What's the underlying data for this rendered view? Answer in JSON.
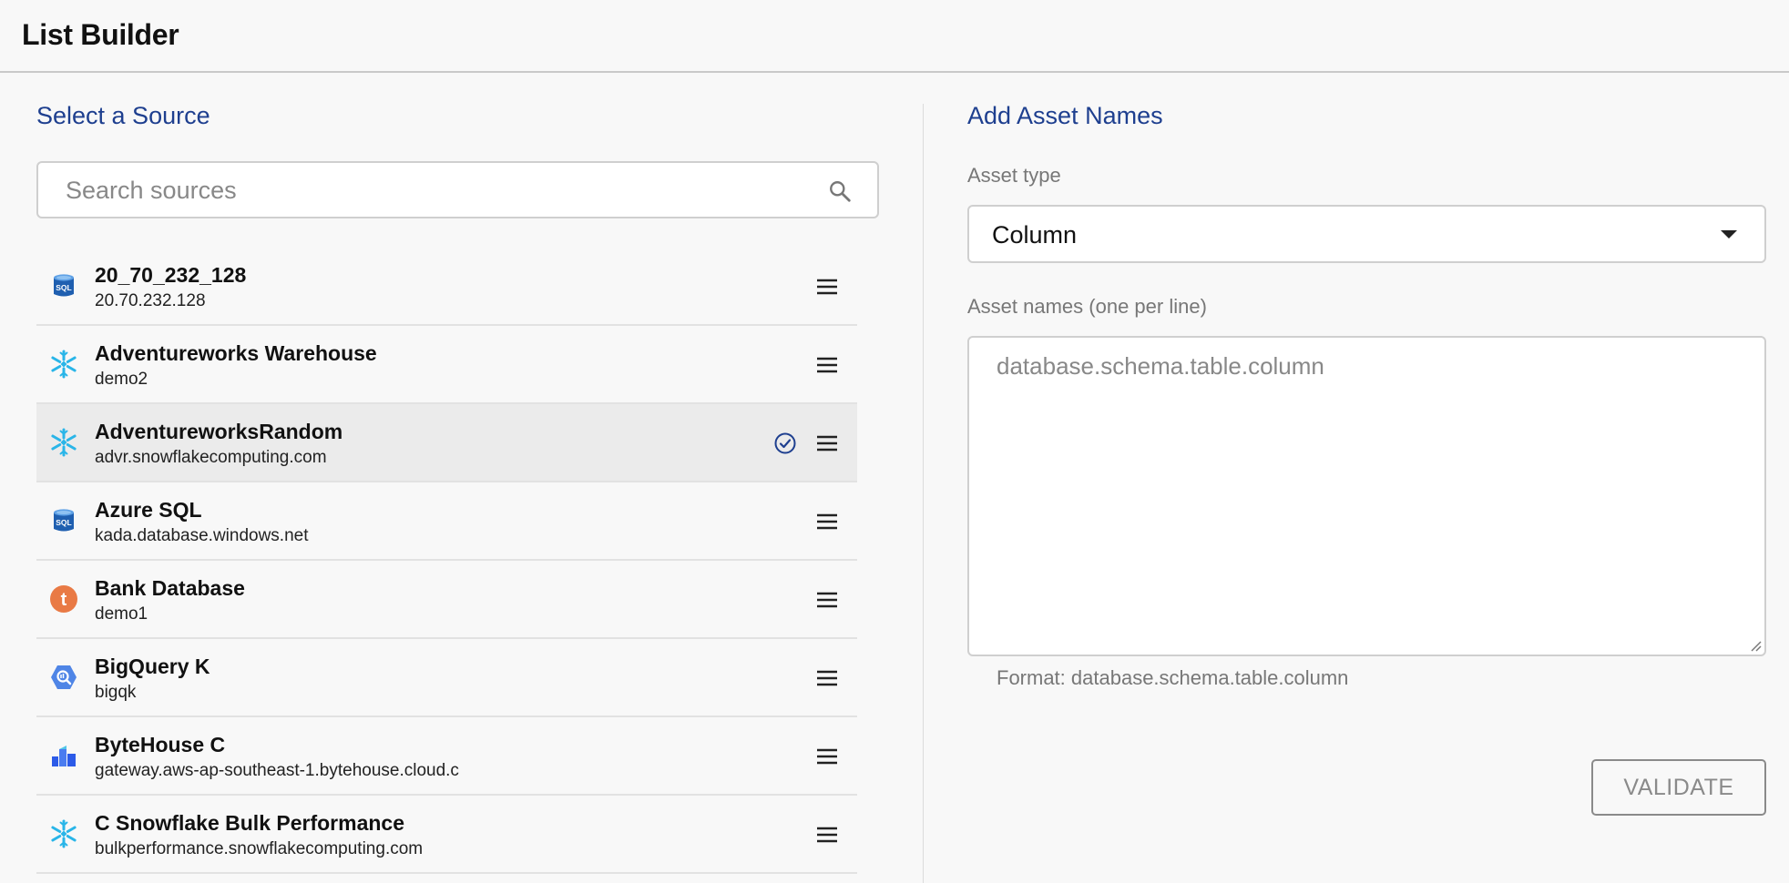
{
  "app": {
    "title": "List Builder"
  },
  "left_panel": {
    "title": "Select a Source",
    "search": {
      "placeholder": "Search sources",
      "value": ""
    },
    "sources": [
      {
        "name": "20_70_232_128",
        "host": "20.70.232.128",
        "icon": "sql-database-icon",
        "selected": false
      },
      {
        "name": "Adventureworks Warehouse",
        "host": "demo2",
        "icon": "snowflake-icon",
        "selected": false
      },
      {
        "name": "AdventureworksRandom",
        "host": "advr.snowflakecomputing.com",
        "icon": "snowflake-icon",
        "selected": true
      },
      {
        "name": "Azure SQL",
        "host": "kada.database.windows.net",
        "icon": "sql-database-icon",
        "selected": false
      },
      {
        "name": "Bank Database",
        "host": "demo1",
        "icon": "tableau-t-icon",
        "selected": false
      },
      {
        "name": "BigQuery K",
        "host": "bigqk",
        "icon": "bigquery-icon",
        "selected": false
      },
      {
        "name": "ByteHouse C",
        "host": "gateway.aws-ap-southeast-1.bytehouse.cloud.c",
        "icon": "bytehouse-icon",
        "selected": false
      },
      {
        "name": "C Snowflake Bulk Performance",
        "host": "bulkperformance.snowflakecomputing.com",
        "icon": "snowflake-icon",
        "selected": false
      }
    ]
  },
  "right_panel": {
    "title": "Add Asset Names",
    "asset_type_label": "Asset type",
    "asset_type_value": "Column",
    "asset_names_label": "Asset names (one per line)",
    "asset_names_placeholder": "database.schema.table.column",
    "asset_names_value": "",
    "helper_text": "Format: database.schema.table.column",
    "validate_label": "VALIDATE"
  },
  "colors": {
    "accent": "#1e3f8f",
    "selected_row": "#ebebeb",
    "snowflake": "#29b5e8",
    "sql_blue": "#1f5fb0",
    "tableau_orange": "#e97a45",
    "bigquery_blue": "#4f85e6"
  }
}
